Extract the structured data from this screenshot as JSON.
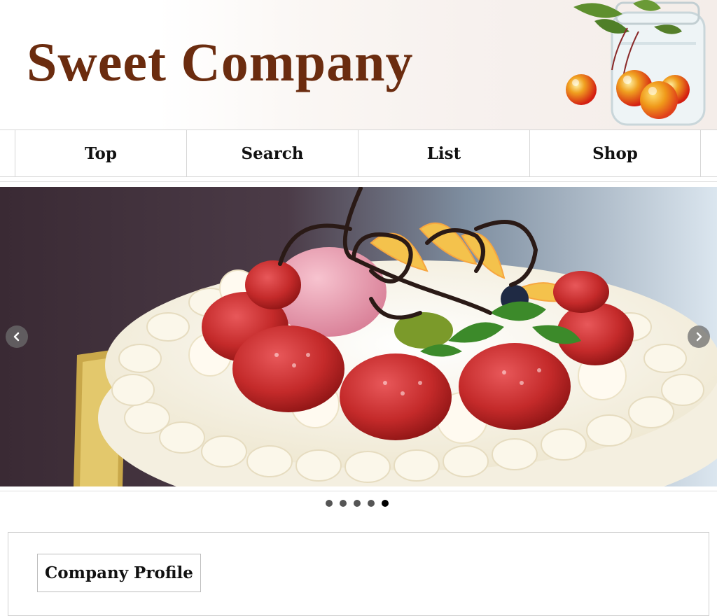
{
  "header": {
    "site_title": "Sweet Company",
    "title_color": "#6b2c0f"
  },
  "nav": {
    "items": [
      {
        "label": "Top"
      },
      {
        "label": "Search"
      },
      {
        "label": "List"
      },
      {
        "label": "Shop"
      }
    ]
  },
  "slider": {
    "image": "strawberry-cake-photo",
    "prev_icon": "chevron-left-icon",
    "next_icon": "chevron-right-icon",
    "slide_count": 5,
    "active_slide": 5
  },
  "content": {
    "section_title": "Company Profile"
  }
}
